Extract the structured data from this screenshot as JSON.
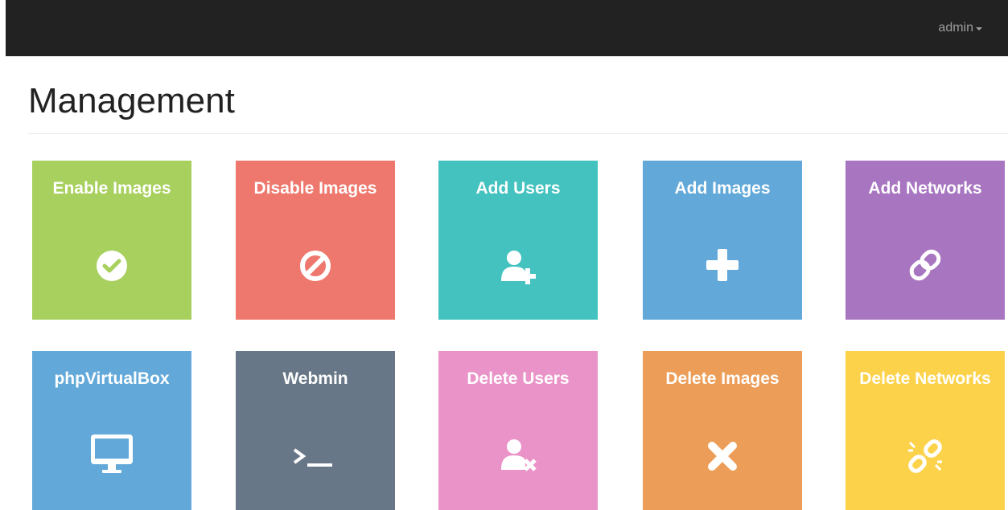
{
  "navbar": {
    "user_label": "admin"
  },
  "page": {
    "title": "Management"
  },
  "tiles": [
    {
      "label": "Enable Images",
      "color": "#a8d05e",
      "icon": "check-circle-icon"
    },
    {
      "label": "Disable Images",
      "color": "#ee786d",
      "icon": "ban-icon"
    },
    {
      "label": "Add Users",
      "color": "#43c2bf",
      "icon": "user-plus-icon"
    },
    {
      "label": "Add Images",
      "color": "#62a9da",
      "icon": "plus-icon"
    },
    {
      "label": "Add Networks",
      "color": "#a875c1",
      "icon": "link-icon"
    },
    {
      "label": "phpVirtualBox",
      "color": "#62a9da",
      "icon": "desktop-icon"
    },
    {
      "label": "Webmin",
      "color": "#677787",
      "icon": "terminal-icon"
    },
    {
      "label": "Delete Users",
      "color": "#ea93c8",
      "icon": "user-times-icon"
    },
    {
      "label": "Delete Images",
      "color": "#ec9d58",
      "icon": "times-icon"
    },
    {
      "label": "Delete Networks",
      "color": "#fcd24b",
      "icon": "unlink-icon"
    }
  ]
}
